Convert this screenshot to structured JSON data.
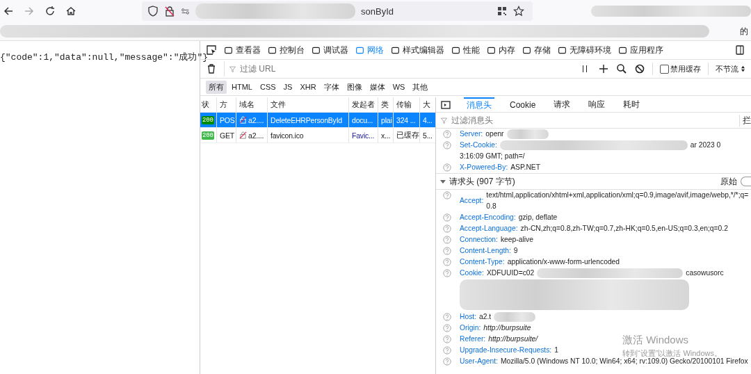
{
  "browser": {
    "url": {
      "visible_end": "sonById"
    },
    "bookmarks": {
      "visible_end": "的"
    }
  },
  "page": {
    "body": "{\"code\":1,\"data\":null,\"message\":\"成功\"}"
  },
  "devtools": {
    "tabs": [
      {
        "label": "查看器",
        "selected": false
      },
      {
        "label": "控制台",
        "selected": false
      },
      {
        "label": "调试器",
        "selected": false
      },
      {
        "label": "网络",
        "selected": true
      },
      {
        "label": "样式编辑器",
        "selected": false
      },
      {
        "label": "性能",
        "selected": false
      },
      {
        "label": "内存",
        "selected": false
      },
      {
        "label": "存储",
        "selected": false
      },
      {
        "label": "无障碍环境",
        "selected": false
      },
      {
        "label": "应用程序",
        "selected": false
      }
    ],
    "url_filter": {
      "placeholder": "过滤 URL"
    },
    "disable_cache": {
      "label": "禁用缓存",
      "checked": false
    },
    "throttle": "不节流",
    "type_filters": [
      {
        "label": "所有",
        "selected": true
      },
      {
        "label": "HTML",
        "selected": false
      },
      {
        "label": "CSS",
        "selected": false
      },
      {
        "label": "JS",
        "selected": false
      },
      {
        "label": "XHR",
        "selected": false
      },
      {
        "label": "字体",
        "selected": false
      },
      {
        "label": "图像",
        "selected": false
      },
      {
        "label": "媒体",
        "selected": false
      },
      {
        "label": "WS",
        "selected": false
      },
      {
        "label": "其他",
        "selected": false
      }
    ],
    "requests": {
      "columns": [
        "状",
        "方",
        "域名",
        "文件",
        "发起者",
        "类",
        "传输",
        "大"
      ],
      "rows": [
        {
          "status": "200",
          "method": "POS",
          "domain": "a2....",
          "file": "DeleteEHRPersonById",
          "initiator": "docu...",
          "type": "plai",
          "transferred": "324 ...",
          "size": "4...",
          "selected": true
        },
        {
          "status": "200",
          "method": "GET",
          "domain": "a2....",
          "file": "favicon.ico",
          "initiator": "Favic...",
          "type": "x...",
          "transferred": "已缓存",
          "size": "5...",
          "selected": false
        }
      ]
    },
    "details": {
      "tabs": [
        {
          "label": "消息头",
          "selected": true
        },
        {
          "label": "Cookie",
          "selected": false
        },
        {
          "label": "请求",
          "selected": false
        },
        {
          "label": "响应",
          "selected": false
        },
        {
          "label": "耗时",
          "selected": false
        }
      ],
      "filter": {
        "placeholder": "过滤消息头"
      },
      "block_label": "拦",
      "response_headers": [
        {
          "name": "Server:",
          "value": "openr",
          "redacted": true
        },
        {
          "name": "Set-Cookie:",
          "redacted": true,
          "value_after_blur": "ar 2023 0",
          "continuation": "3:16:09 GMT; path=/"
        },
        {
          "name": "X-Powered-By:",
          "value": "ASP.NET"
        }
      ],
      "request_section": {
        "title": "请求头 (907 字节)",
        "expanded": true,
        "raw_label": "原始",
        "raw_on": false
      },
      "request_headers": [
        {
          "name": "Accept:",
          "value": "text/html,application/xhtml+xml,application/xml;q=0.9,image/avif,image/webp,*/*;q=0.8"
        },
        {
          "name": "Accept-Encoding:",
          "value": "gzip, deflate"
        },
        {
          "name": "Accept-Language:",
          "value": "zh-CN,zh;q=0.8,zh-TW;q=0.7,zh-HK;q=0.5,en-US;q=0.3,en;q=0.2"
        },
        {
          "name": "Connection:",
          "value": "keep-alive"
        },
        {
          "name": "Content-Length:",
          "value": "9"
        },
        {
          "name": "Content-Type:",
          "value": "application/x-www-form-urlencoded"
        },
        {
          "name": "Cookie:",
          "value": "XDFUUID=c02",
          "redacted": true,
          "value_after_blur": "casowusorc",
          "redacted_block": true
        },
        {
          "name": "Host:",
          "value": "a2.t",
          "redacted": true
        },
        {
          "name": "Origin:",
          "value": "http://burpsuite",
          "italic": true
        },
        {
          "name": "Referer:",
          "value": "http://burpsuite/",
          "italic": true
        },
        {
          "name": "Upgrade-Insecure-Requests:",
          "value": "1"
        },
        {
          "name": "User-Agent:",
          "value": "Mozilla/5.0 (Windows NT 10.0; Win64; x64; rv:109.0) Gecko/20100101 Firefox"
        }
      ]
    }
  },
  "os_overlay": {
    "title": "激活 Windows",
    "subtitle": "转到“设置”以激活 Windows。"
  }
}
